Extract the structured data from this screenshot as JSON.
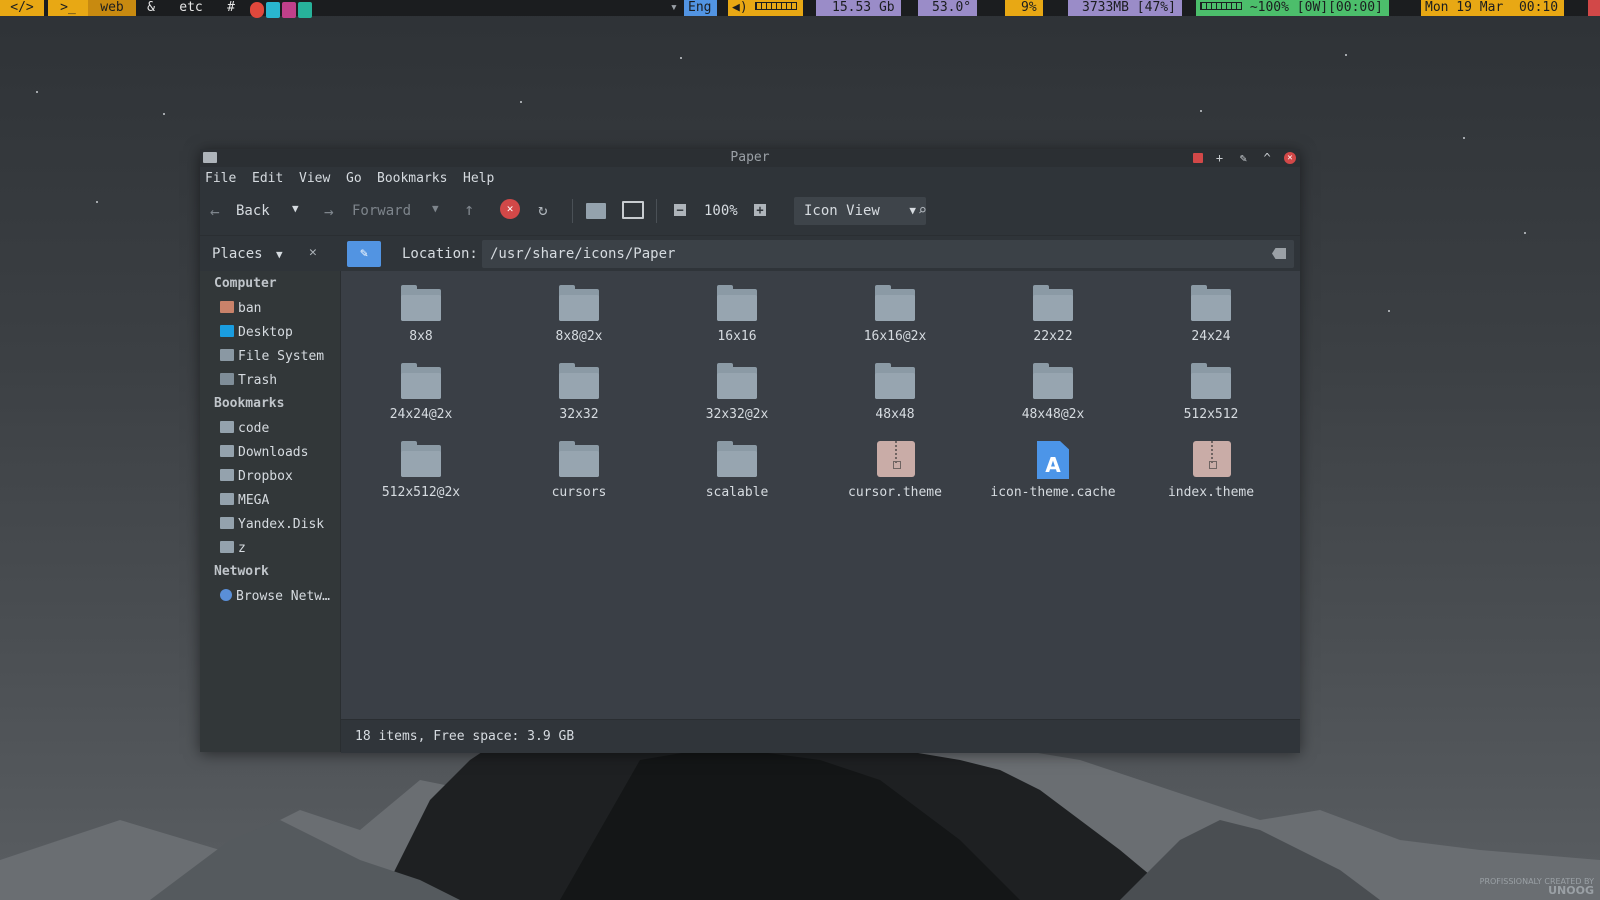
{
  "panel": {
    "workspaces": [
      "</>",
      ">_",
      "web",
      "&",
      "etc",
      "#"
    ],
    "language": "Eng",
    "disk": "15.53 Gb",
    "temperature": "53.0°",
    "cpu": "9%",
    "memory": "3733MB [47%]",
    "battery": "~100% [0W][00:00]",
    "date": "Mon 19 Mar",
    "time": "00:10"
  },
  "window": {
    "title": "Paper",
    "menus": [
      "File",
      "Edit",
      "View",
      "Go",
      "Bookmarks",
      "Help"
    ],
    "toolbar": {
      "back_label": "Back",
      "forward_label": "Forward",
      "zoom_level": "100%",
      "view_mode": "Icon View"
    },
    "location": {
      "places_label": "Places",
      "label": "Location:",
      "path": "/usr/share/icons/Paper"
    },
    "sidebar": {
      "sections": [
        {
          "title": "Computer",
          "items": [
            {
              "label": "ban",
              "icon": "home-icon"
            },
            {
              "label": "Desktop",
              "icon": "desktop-icon"
            },
            {
              "label": "File System",
              "icon": "filesystem-icon"
            },
            {
              "label": "Trash",
              "icon": "trash-icon"
            }
          ]
        },
        {
          "title": "Bookmarks",
          "items": [
            {
              "label": "code",
              "icon": "folder-icon"
            },
            {
              "label": "Downloads",
              "icon": "folder-icon"
            },
            {
              "label": "Dropbox",
              "icon": "folder-icon"
            },
            {
              "label": "MEGA",
              "icon": "folder-icon"
            },
            {
              "label": "Yandex.Disk",
              "icon": "folder-icon"
            },
            {
              "label": "z",
              "icon": "folder-icon"
            }
          ]
        },
        {
          "title": "Network",
          "items": [
            {
              "label": "Browse Netw…",
              "icon": "network-icon"
            }
          ]
        }
      ]
    },
    "files": [
      {
        "name": "8x8",
        "type": "folder"
      },
      {
        "name": "8x8@2x",
        "type": "folder"
      },
      {
        "name": "16x16",
        "type": "folder"
      },
      {
        "name": "16x16@2x",
        "type": "folder"
      },
      {
        "name": "22x22",
        "type": "folder"
      },
      {
        "name": "24x24",
        "type": "folder"
      },
      {
        "name": "24x24@2x",
        "type": "folder"
      },
      {
        "name": "32x32",
        "type": "folder"
      },
      {
        "name": "32x32@2x",
        "type": "folder"
      },
      {
        "name": "48x48",
        "type": "folder"
      },
      {
        "name": "48x48@2x",
        "type": "folder"
      },
      {
        "name": "512x512",
        "type": "folder"
      },
      {
        "name": "512x512@2x",
        "type": "folder"
      },
      {
        "name": "cursors",
        "type": "folder"
      },
      {
        "name": "scalable",
        "type": "folder"
      },
      {
        "name": "cursor.theme",
        "type": "archive"
      },
      {
        "name": "icon-theme.cache",
        "type": "document"
      },
      {
        "name": "index.theme",
        "type": "archive"
      }
    ],
    "status": "18 items, Free space: 3.9 GB"
  },
  "colors": {
    "accent": "#5294e2",
    "panel_highlight": "#e8a814",
    "close": "#d24848"
  }
}
